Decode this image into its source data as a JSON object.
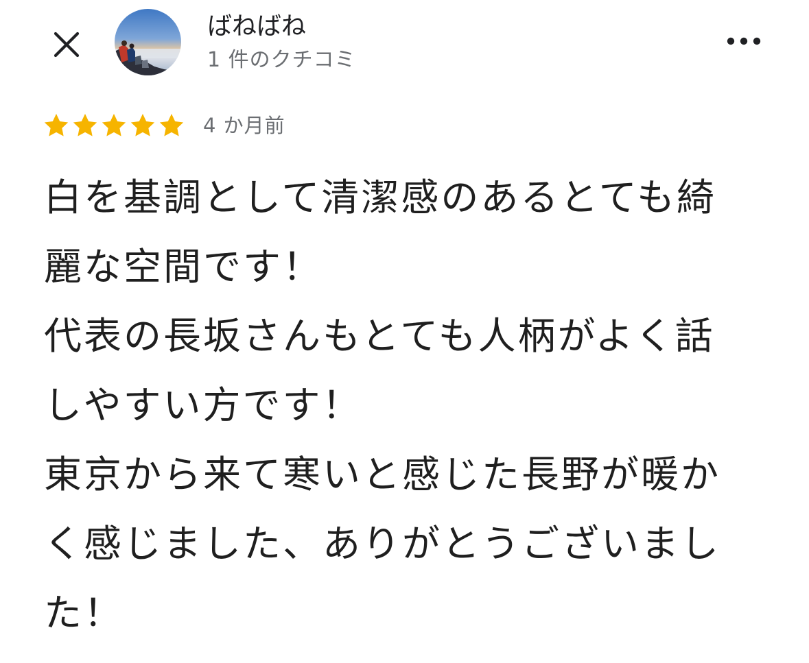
{
  "header": {
    "close_icon": "close-icon",
    "avatar_icon": "profile-photo-mountain-sunrise",
    "user_name": "ばねばね",
    "review_count": "1 件のクチコミ",
    "more_icon": "more-horizontal-icon"
  },
  "review": {
    "rating": 5,
    "rating_max": 5,
    "star_color": "#f6b400",
    "time": "4 か月前",
    "text": "白を基調として清潔感のあるとても綺麗な空間です！\n代表の長坂さんもとても人柄がよく話しやすい方です！\n東京から来て寒いと感じた長野が暖かく感じました、ありがとうございました！"
  }
}
